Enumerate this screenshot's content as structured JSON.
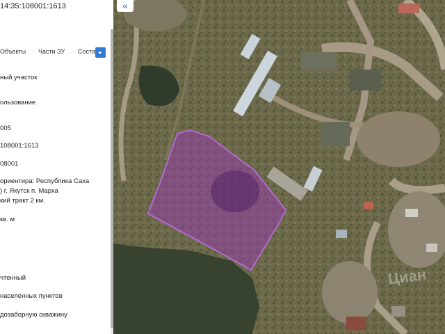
{
  "cadastral_number": "14:35:108001:1613",
  "tabs": [
    "Объекты",
    "Части ЗУ",
    "Соста"
  ],
  "tab_next_label": "▸",
  "fields": [
    "ный участок",
    "ользование",
    "005",
    "108001:1613",
    "08001",
    "ориентира: Республика Саха",
    ") г. Якутск п. Марха",
    "кий тракт 2 км.",
    "кв. м",
    "чтенный",
    "населенных пунктов",
    "дозаборную скважину"
  ],
  "collapse_label": "«",
  "watermark": "Циан"
}
